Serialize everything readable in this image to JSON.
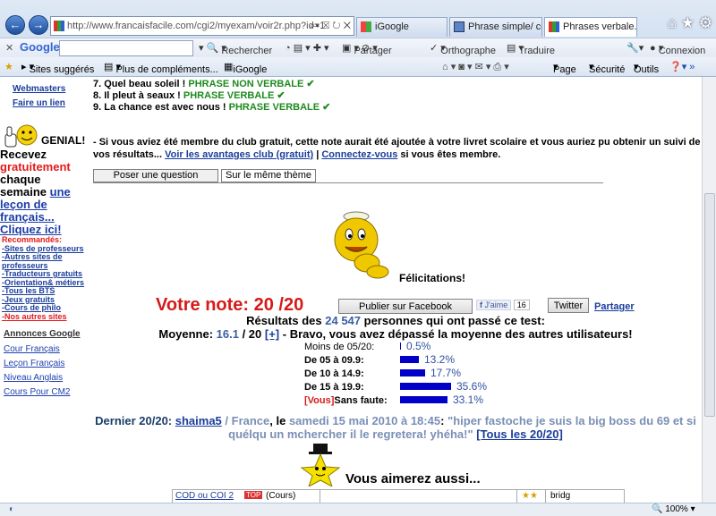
{
  "browser": {
    "url": "http://www.francaisfacile.com/cgi2/myexam/voir2r.php?id=1",
    "tabs": [
      {
        "label": "iGoogle"
      },
      {
        "label": "Phrase simple/ co..."
      },
      {
        "label": "Phrases verbale..."
      }
    ]
  },
  "google_bar": {
    "logo": "Google",
    "rechercher": "Rechercher",
    "partager": "Partager",
    "orthographe": "Orthographe",
    "traduire": "Traduire",
    "connexion": "Connexion"
  },
  "favorites_bar": {
    "sites_suggeres": "Sites suggérés",
    "plus_complements": "Plus de compléments...",
    "igoogle": "iGoogle",
    "page": "Page",
    "securite": "Sécurité",
    "outils": "Outils"
  },
  "sidebar": {
    "links_top": [
      "Webmasters",
      "Faire un lien"
    ],
    "genial": "GENIAL!",
    "recevez": "Recevez",
    "gratuitement": "gratuitement",
    "chaque": "chaque",
    "semaine": "semaine",
    "lecon_link": "une leçon de français...",
    "cliquez": "Cliquez ici!",
    "recommandes": "Recommandés:",
    "reco_links": [
      "-Sites de professeurs",
      "-Autres sites de professeurs",
      "-Traducteurs gratuits",
      "-Orientation& métiers",
      "-Tous les BTS",
      "-Jeux gratuits",
      "-Cours de philo",
      "-Nos autres sites"
    ],
    "annonces_title": "Annonces Google",
    "annonces": [
      "Cour Français",
      "Leçon Français",
      "Niveau Anglais",
      "Cours Pour CM2"
    ]
  },
  "exercise_items": [
    {
      "text": "7. Quel beau soleil ! ",
      "answer": "PHRASE NON VERBALE ✔"
    },
    {
      "text": "8. Il pleut à seaux ! ",
      "answer": "PHRASE VERBALE ✔"
    },
    {
      "text": "9. La chance est avec nous ! ",
      "answer": "PHRASE VERBALE ✔"
    }
  ],
  "club_note": {
    "text1": "- Si vous aviez été membre du club gratuit, cette note aurait été ajoutée à votre livret scolaire et vous auriez pu obtenir un suivi de vos résultats... ",
    "link1": "Voir les avantages club (gratuit)",
    "sep": " | ",
    "link2": "Connectez-vous",
    "text2": " si vous êtes membre."
  },
  "tabs_box": [
    "Poser une question",
    "Sur le même thème"
  ],
  "felicitations": "Félicitations!",
  "score": {
    "label": "Votre note: 20 /20",
    "facebook_btn": "Publier sur Facebook",
    "jaime": "J'aime",
    "likes": "16",
    "twitter_btn": "Twitter",
    "partager": "Partager"
  },
  "results": {
    "line_pre": "Résultats des ",
    "count": "24 547",
    "line_post": " personnes qui ont passé ce test:",
    "moyenne_label": "Moyenne: ",
    "moyenne_value": "16.1",
    "moyenne_sep": " / 20 ",
    "plus": "[+]",
    "moyenne_rest": " - Bravo, vous avez dépassé la moyenne des autres utilisateurs!"
  },
  "distribution": [
    {
      "label": "Moins de 05/20:",
      "value": 0.5,
      "text": "0.5%"
    },
    {
      "label": "De 05 à 09.9:",
      "value": 13.2,
      "text": "13.2%"
    },
    {
      "label": "De 10 à 14.9:",
      "value": 17.7,
      "text": "17.7%"
    },
    {
      "label": "De 15 à 19.9:",
      "value": 35.6,
      "text": "35.6%"
    },
    {
      "label_vous": "[Vous]",
      "label": "Sans faute:",
      "value": 33.1,
      "text": "33.1%"
    }
  ],
  "last": {
    "prefix": "Dernier 20/20: ",
    "user": "shaima5",
    "country": " / France",
    "le": ", le ",
    "date": "samedi 15 mai 2010 à 18:45",
    "colon": ": ",
    "quote": "\"hiper fastoche je suis la big boss du 69 et si quélqu un mchercher il le regretera! yhéha!\"",
    "all_link": "[Tous les 20/20]"
  },
  "vous_aimerez": "Vous aimerez aussi...",
  "bottom_table": {
    "c1": "COD ou COI 2",
    "c2": "(Cours)",
    "c3": "bridg"
  },
  "status": {
    "zoom": "100%"
  }
}
